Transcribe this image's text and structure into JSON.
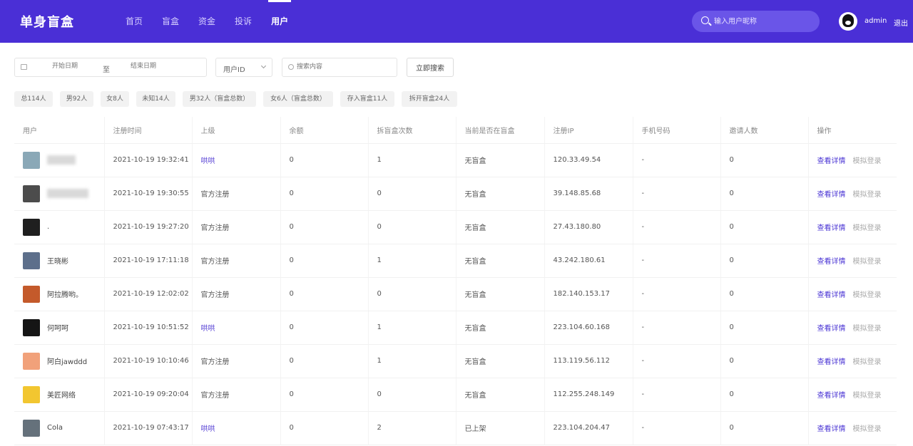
{
  "header": {
    "logo": "单身盲盒",
    "nav": [
      "首页",
      "盲盒",
      "资金",
      "投诉",
      "用户"
    ],
    "active_nav": "用户",
    "search_placeholder": "输入用户昵称",
    "username": "admin",
    "logout": "退出",
    "colors": {
      "primary": "#4a2fd6",
      "accent": "#5a45d6"
    }
  },
  "filters": {
    "start_placeholder": "开始日期",
    "separator": "至",
    "end_placeholder": "结束日期",
    "select_value": "用户ID",
    "content_placeholder": "搜索内容",
    "search_button": "立即搜索"
  },
  "stats": [
    "总114人",
    "男92人",
    "女8人",
    "未知14人",
    "男32人（盲盒总数）",
    "女6人（盲盒总数）",
    "存入盲盒11人",
    "拆开盲盒24人"
  ],
  "table": {
    "columns": [
      "用户",
      "注册时间",
      "上级",
      "余额",
      "拆盲盒次数",
      "当前是否在盲盒",
      "注册IP",
      "手机号码",
      "邀请人数",
      "操作"
    ],
    "rows": [
      {
        "name": "",
        "blurred_width": 40,
        "avatar": "#8aa8b7",
        "reg_time": "2021-10-19 19:32:41",
        "superior": "哄哄",
        "superior_link": true,
        "balance": "0",
        "open_count": "1",
        "in_box": "无盲盒",
        "ip": "120.33.49.54",
        "phone": "-",
        "invites": "0"
      },
      {
        "name": "",
        "blurred_width": 58,
        "avatar": "#4c4c4c",
        "reg_time": "2021-10-19 19:30:55",
        "superior": "官方注册",
        "superior_link": false,
        "balance": "0",
        "open_count": "0",
        "in_box": "无盲盒",
        "ip": "39.148.85.68",
        "phone": "-",
        "invites": "0"
      },
      {
        "name": ".",
        "blurred_width": 0,
        "avatar": "#1f1f1f",
        "reg_time": "2021-10-19 19:27:20",
        "superior": "官方注册",
        "superior_link": false,
        "balance": "0",
        "open_count": "0",
        "in_box": "无盲盒",
        "ip": "27.43.180.80",
        "phone": "-",
        "invites": "0"
      },
      {
        "name": "王晓彬",
        "blurred_width": 0,
        "avatar": "#5d6f8b",
        "reg_time": "2021-10-19 17:11:18",
        "superior": "官方注册",
        "superior_link": false,
        "balance": "0",
        "open_count": "1",
        "in_box": "无盲盒",
        "ip": "43.242.180.61",
        "phone": "-",
        "invites": "0"
      },
      {
        "name": "阿拉腾哟。",
        "blurred_width": 0,
        "avatar": "#c45a2b",
        "reg_time": "2021-10-19 12:02:02",
        "superior": "官方注册",
        "superior_link": false,
        "balance": "0",
        "open_count": "0",
        "in_box": "无盲盒",
        "ip": "182.140.153.17",
        "phone": "-",
        "invites": "0"
      },
      {
        "name": "何呵呵",
        "blurred_width": 0,
        "avatar": "#151515",
        "reg_time": "2021-10-19 10:51:52",
        "superior": "哄哄",
        "superior_link": true,
        "balance": "0",
        "open_count": "1",
        "in_box": "无盲盒",
        "ip": "223.104.60.168",
        "phone": "-",
        "invites": "0"
      },
      {
        "name": "阿白jawddd",
        "blurred_width": 0,
        "avatar": "#f1a17a",
        "reg_time": "2021-10-19 10:10:46",
        "superior": "官方注册",
        "superior_link": false,
        "balance": "0",
        "open_count": "1",
        "in_box": "无盲盒",
        "ip": "113.119.56.112",
        "phone": "-",
        "invites": "0"
      },
      {
        "name": "美匠网络",
        "blurred_width": 0,
        "avatar": "#f2c630",
        "reg_time": "2021-10-19 09:20:04",
        "superior": "官方注册",
        "superior_link": false,
        "balance": "0",
        "open_count": "0",
        "in_box": "无盲盒",
        "ip": "112.255.248.149",
        "phone": "-",
        "invites": "0"
      },
      {
        "name": "Cola",
        "blurred_width": 0,
        "avatar": "#65717b",
        "reg_time": "2021-10-19 07:43:17",
        "superior": "哄哄",
        "superior_link": true,
        "balance": "0",
        "open_count": "2",
        "in_box": "已上架",
        "ip": "223.104.204.47",
        "phone": "-",
        "invites": "0"
      }
    ],
    "actions": [
      "查看详情",
      "模拟登录"
    ]
  }
}
